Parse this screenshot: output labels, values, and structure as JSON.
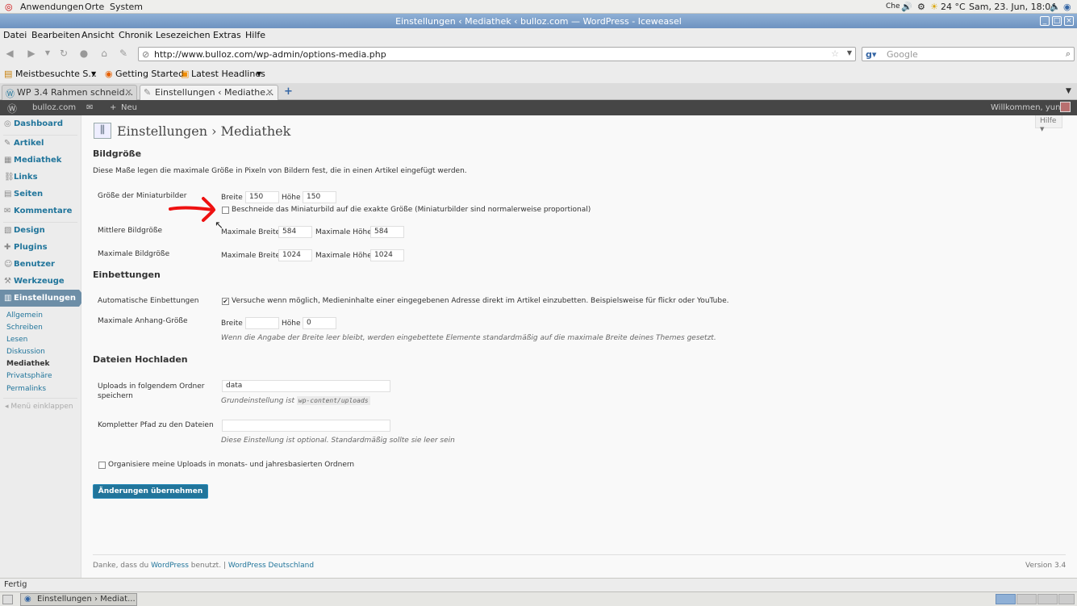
{
  "gnome": {
    "menus": [
      "Anwendungen",
      "Orte",
      "System"
    ],
    "keyboard": "Che",
    "temperature": "24 °C",
    "clock": "Sam, 23. Jun, 18:04"
  },
  "window": {
    "title": "Einstellungen ‹ Mediathek ‹ bulloz.com — WordPress - Iceweasel"
  },
  "menubar": [
    "Datei",
    "Bearbeiten",
    "Ansicht",
    "Chronik",
    "Lesezeichen",
    "Extras",
    "Hilfe"
  ],
  "nav": {
    "url": "http://www.bulloz.com/wp-admin/options-media.php",
    "search_placeholder": "Google"
  },
  "bookmarks": [
    "Meistbesuchte S...",
    "Getting Started",
    "Latest Headlines"
  ],
  "tabs": [
    {
      "label": "WP 3.4 Rahmen schneid..."
    },
    {
      "label": "Einstellungen ‹ Mediathe..."
    }
  ],
  "adminbar": {
    "site": "bulloz.com",
    "new": "Neu",
    "welcome": "Willkommen, yuna"
  },
  "sidebar": {
    "items": [
      "Dashboard",
      "Artikel",
      "Mediathek",
      "Links",
      "Seiten",
      "Kommentare",
      "Design",
      "Plugins",
      "Benutzer",
      "Werkzeuge",
      "Einstellungen"
    ],
    "sub": [
      "Allgemein",
      "Schreiben",
      "Lesen",
      "Diskussion",
      "Mediathek",
      "Privatsphäre",
      "Permalinks"
    ],
    "collapse": "Menü einklappen"
  },
  "page": {
    "title": "Einstellungen › Mediathek",
    "help": "Hilfe",
    "image_sizes": {
      "heading": "Bildgröße",
      "intro": "Diese Maße legen die maximale Größe in Pixeln von Bildern fest, die in einen Artikel eingefügt werden.",
      "thumb_label": "Größe der Miniaturbilder",
      "width": "Breite",
      "height": "Höhe",
      "thumb_w": "150",
      "thumb_h": "150",
      "crop_label": "Beschneide das Miniaturbild auf die exakte Größe (Miniaturbilder sind normalerweise proportional)",
      "medium_label": "Mittlere Bildgröße",
      "max_width": "Maximale Breite",
      "max_height": "Maximale Höhe",
      "medium_w": "584",
      "medium_h": "584",
      "large_label": "Maximale Bildgröße",
      "large_w": "1024",
      "large_h": "1024"
    },
    "embeds": {
      "heading": "Einbettungen",
      "auto_label": "Automatische Einbettungen",
      "auto_text": "Versuche wenn möglich, Medieninhalte einer eingegebenen Adresse direkt im Artikel einzubetten. Beispielsweise für flickr oder YouTube.",
      "max_label": "Maximale Anhang-Größe",
      "embed_w": "",
      "embed_h": "0",
      "max_desc": "Wenn die Angabe der Breite leer bleibt, werden eingebettete Elemente standardmäßig auf die maximale Breite deines Themes gesetzt."
    },
    "uploads": {
      "heading": "Dateien Hochladen",
      "folder_label": "Uploads in folgendem Ordner speichern",
      "folder_value": "data",
      "folder_desc": "Grundeinstellung ist",
      "folder_default": "wp-content/uploads",
      "path_label": "Kompletter Pfad zu den Dateien",
      "path_value": "",
      "path_desc": "Diese Einstellung ist optional. Standardmäßig sollte sie leer sein",
      "organize": "Organisiere meine Uploads in monats- und jahresbasierten Ordnern"
    },
    "submit": "Änderungen übernehmen",
    "footer": {
      "thanks": "Danke, dass du",
      "wp": "WordPress",
      "used": "benutzt.",
      "sep": "|",
      "de": "WordPress Deutschland",
      "version": "Version 3.4"
    }
  },
  "status": "Fertig",
  "taskbar": {
    "window": "Einstellungen › Mediat..."
  },
  "colors": {
    "link": "#21759b",
    "button": "#21759b",
    "arrow": "#ee1111"
  }
}
